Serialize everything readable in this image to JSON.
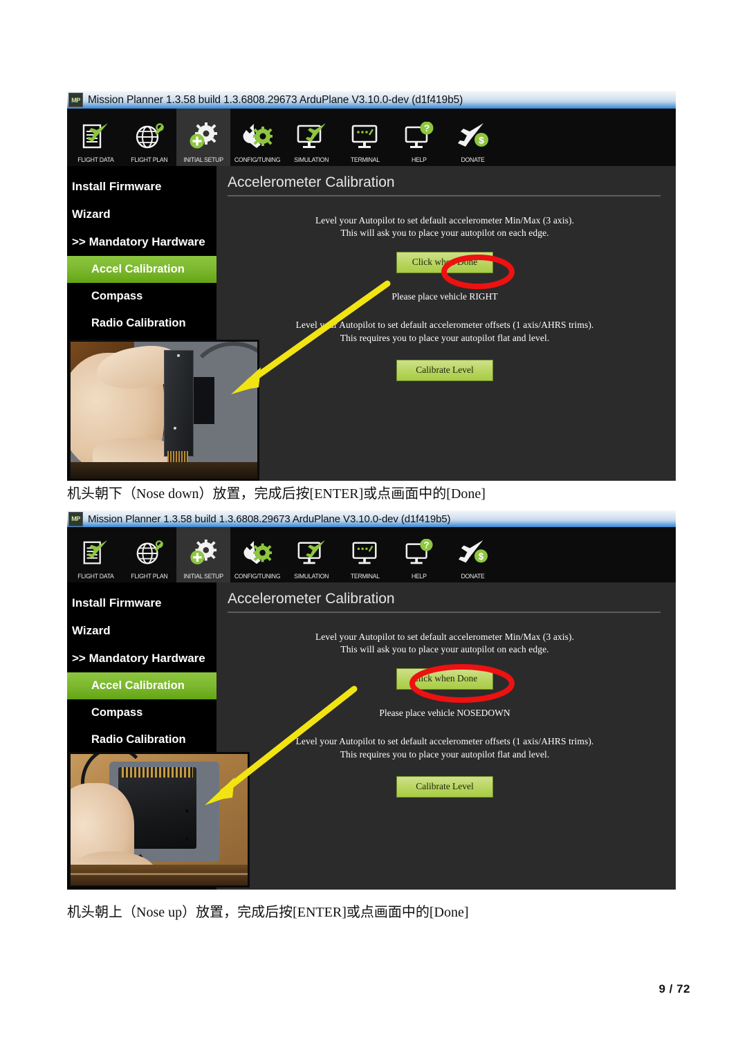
{
  "document": {
    "page_number": "9 / 72",
    "captions": [
      "机头朝下（Nose down）放置，完成后按[ENTER]或点画面中的[Done]",
      "机头朝上（Nose up）放置，完成后按[ENTER]或点画面中的[Done]"
    ]
  },
  "colors": {
    "accent_green": "#8dc63f",
    "button_green": "#bcd766",
    "annotation_red": "#ee1111",
    "annotation_yellow": "#f2e413",
    "window_dark": "#1e1e1e",
    "sidebar_black": "#000000",
    "titlebar_blue": "#4a93d9"
  },
  "window": {
    "title": "Mission Planner 1.3.58 build 1.3.6808.29673 ArduPlane V3.10.0-dev (d1f419b5)",
    "app_icon_text": "MP",
    "toolbar": [
      {
        "label": "FLIGHT DATA",
        "icon": "flight-data-icon",
        "active": false
      },
      {
        "label": "FLIGHT PLAN",
        "icon": "flight-plan-icon",
        "active": false
      },
      {
        "label": "INITIAL SETUP",
        "icon": "initial-setup-icon",
        "active": true
      },
      {
        "label": "CONFIG/TUNING",
        "icon": "config-tuning-icon",
        "active": false
      },
      {
        "label": "SIMULATION",
        "icon": "simulation-icon",
        "active": false
      },
      {
        "label": "TERMINAL",
        "icon": "terminal-icon",
        "active": false
      },
      {
        "label": "HELP",
        "icon": "help-icon",
        "active": false
      },
      {
        "label": "DONATE",
        "icon": "donate-icon",
        "active": false
      }
    ],
    "sidebar": [
      {
        "label": "Install Firmware",
        "indented": false,
        "selected": false
      },
      {
        "label": "Wizard",
        "indented": false,
        "selected": false
      },
      {
        "label": ">> Mandatory Hardware",
        "indented": false,
        "selected": false
      },
      {
        "label": "Accel Calibration",
        "indented": true,
        "selected": true
      },
      {
        "label": "Compass",
        "indented": true,
        "selected": false
      },
      {
        "label": "Radio Calibration",
        "indented": true,
        "selected": false
      }
    ],
    "content": {
      "title": "Accelerometer Calibration",
      "paragraph1_line1": "Level your Autopilot to set default accelerometer Min/Max (3 axis).",
      "paragraph1_line2": "This will ask you to place your autopilot on each edge.",
      "done_button": "Click when Done",
      "paragraph2_line1": "Level your Autopilot to set default accelerometer offsets (1 axis/AHRS trims).",
      "paragraph2_line2": "This requires you to place your autopilot flat and level.",
      "level_button": "Calibrate Level"
    }
  },
  "screens": [
    {
      "status_text": "Please place vehicle RIGHT",
      "annotation": "red-circle-on-status"
    },
    {
      "status_text": "Please place vehicle NOSEDOWN",
      "annotation": "red-circle-on-status"
    }
  ]
}
